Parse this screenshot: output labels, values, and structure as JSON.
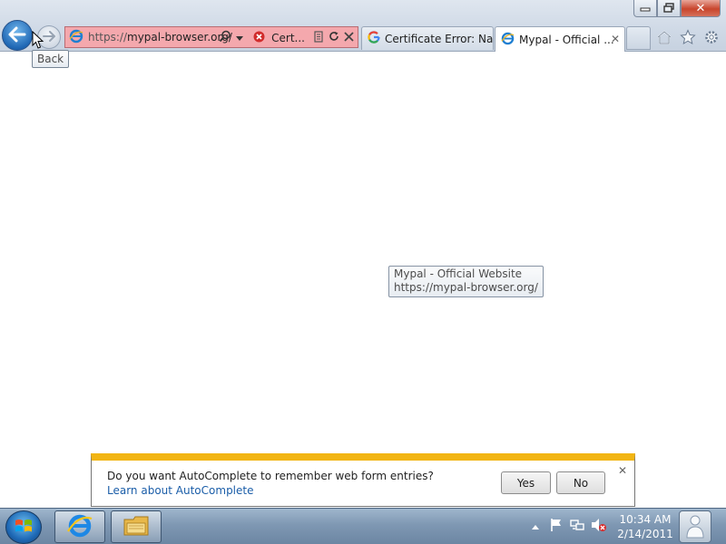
{
  "browser": {
    "window_controls": {
      "minimize": "▭",
      "restore": "⧉",
      "close": "✕"
    },
    "nav": {
      "back_tooltip": "Back"
    },
    "address_bar": {
      "url_prefix": "https://",
      "url_domain": "mypal-browser.org/",
      "cert_label": "Cert...",
      "bg_color": "#f4a8ad"
    },
    "tabs": [
      {
        "label": "Certificate Error: Nav...",
        "icon": "google-icon"
      },
      {
        "label": "Mypal - Official ...",
        "icon": "ie-icon",
        "close": "✕"
      }
    ],
    "right_toolbar": [
      "home-icon",
      "favorites-star-icon",
      "tools-gear-icon"
    ]
  },
  "content": {
    "tab_tooltip": {
      "title": "Mypal - Official Website",
      "url": "https://mypal-browser.org/"
    },
    "notification": {
      "message": "Do you want AutoComplete to remember web form entries?",
      "link": "Learn about AutoComplete",
      "yes_label": "Yes",
      "no_label": "No",
      "close": "✕",
      "accent_color": "#f2b513"
    }
  },
  "taskbar": {
    "pinned": [
      "internet-explorer-icon",
      "file-explorer-icon"
    ],
    "tray_icons": [
      "show-hidden-arrow-icon",
      "action-center-flag-icon",
      "network-icon",
      "volume-muted-icon"
    ],
    "clock": {
      "time": "10:34 AM",
      "date": "2/14/2011"
    }
  }
}
